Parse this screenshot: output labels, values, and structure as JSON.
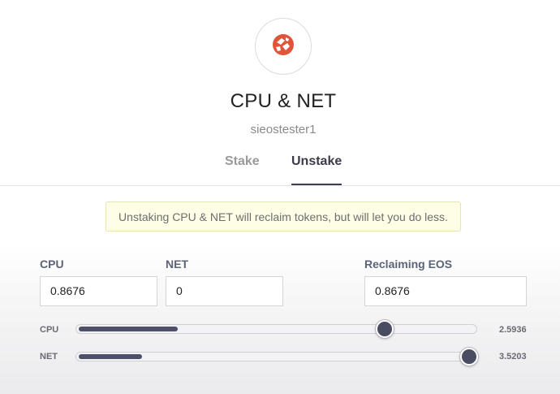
{
  "header": {
    "title": "CPU & NET",
    "account": "sieostester1"
  },
  "tabs": [
    {
      "label": "Stake",
      "active": false
    },
    {
      "label": "Unstake",
      "active": true
    }
  ],
  "notice": "Unstaking CPU & NET will reclaim tokens, but will let you do less.",
  "fields": {
    "cpu": {
      "label": "CPU",
      "value": "0.8676"
    },
    "net": {
      "label": "NET",
      "value": "0"
    },
    "reclaiming": {
      "label": "Reclaiming EOS",
      "value": "0.8676"
    }
  },
  "sliders": {
    "cpu": {
      "label": "CPU",
      "max": "2.5936",
      "fill_fraction": 0.25,
      "thumb_fraction": 0.77
    },
    "net": {
      "label": "NET",
      "max": "3.5203",
      "fill_fraction": 0.16,
      "thumb_fraction": 0.98
    }
  },
  "colors": {
    "accent": "#3d3f55",
    "logo": "#e0553a",
    "notice_bg": "#fefde6"
  },
  "icons": {
    "logo": "eos-network-logo-icon"
  }
}
